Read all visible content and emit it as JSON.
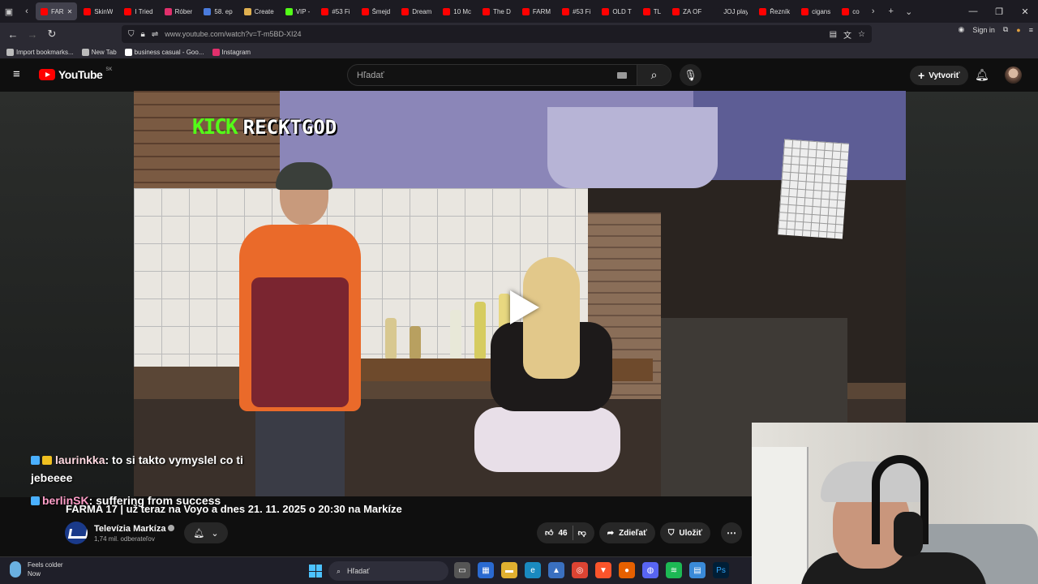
{
  "browser": {
    "tabs": [
      {
        "label": "FAR",
        "color": "#ff0000",
        "active": true
      },
      {
        "label": "SkinW",
        "color": "#ff0000"
      },
      {
        "label": "I Tried",
        "color": "#ff0000"
      },
      {
        "label": "Róber",
        "color": "#e1306c"
      },
      {
        "label": "58. ep",
        "color": "#4a7bdc"
      },
      {
        "label": "Create",
        "color": "#e0b050"
      },
      {
        "label": "VIP -",
        "color": "#53fc18"
      },
      {
        "label": "#53 Fi",
        "color": "#ff0000"
      },
      {
        "label": "Šmejd",
        "color": "#ff0000"
      },
      {
        "label": "Dream",
        "color": "#ff0000"
      },
      {
        "label": "10 Mc",
        "color": "#ff0000"
      },
      {
        "label": "The D",
        "color": "#ff0000"
      },
      {
        "label": "FARM",
        "color": "#ff0000"
      },
      {
        "label": "#53 Fi",
        "color": "#ff0000"
      },
      {
        "label": "OLD T",
        "color": "#ff0000"
      },
      {
        "label": "TL",
        "color": "#ff0000"
      },
      {
        "label": "ZA OF",
        "color": "#ff0000"
      },
      {
        "label": "JOJ play",
        "color": "#1c1b22"
      },
      {
        "label": "Řezník",
        "color": "#ff0000"
      },
      {
        "label": "cigans",
        "color": "#ff0000"
      },
      {
        "label": "co",
        "color": "#ff0000"
      }
    ],
    "url": "www.youtube.com/watch?v=T-m5BD-XI24",
    "sign_in": "Sign in",
    "bookmarks": [
      {
        "label": "Import bookmarks...",
        "color": "#bbbbbb"
      },
      {
        "label": "New Tab",
        "color": "#bbbbbb"
      },
      {
        "label": "business casual - Goo...",
        "color": "#ffffff"
      },
      {
        "label": "Instagram",
        "color": "#e1306c"
      }
    ]
  },
  "youtube": {
    "logo_text": "YouTube",
    "country": "SK",
    "search_placeholder": "Hľadať",
    "create_label": "Vytvoriť"
  },
  "video": {
    "overlay_kick": "KICK",
    "overlay_name": "RECKTGOD",
    "title": "FARMA 17 | už teraz na Voyo a dnes 21. 11. 2025 o 20:30 na Markíze",
    "channel_name": "Televízia Markíza",
    "subscribers": "1,74 mil. odberateľov",
    "likes": "46",
    "share_label": "Zdieľať",
    "save_label": "Uložiť"
  },
  "chat": [
    {
      "user": "laurinkka",
      "message": ": to si takto vymyslel co ti jebeeee"
    },
    {
      "user": "berlinSK",
      "message": ": suffering from success"
    }
  ],
  "taskbar": {
    "weather_title": "Feels colder",
    "weather_sub": "Now",
    "search_placeholder": "Hľadať"
  },
  "colors": {
    "kick_green": "#53fc18",
    "youtube_red": "#ff0000"
  }
}
